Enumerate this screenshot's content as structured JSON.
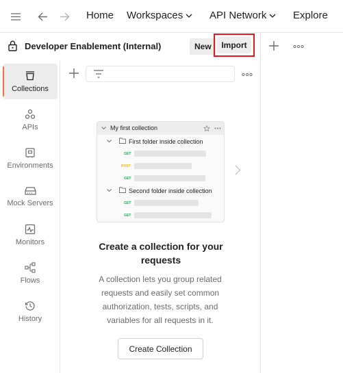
{
  "topnav": {
    "home": "Home",
    "workspaces": "Workspaces",
    "api_network": "API Network",
    "explore": "Explore"
  },
  "workspace": {
    "name": "Developer Enablement (Internal)",
    "new_label": "New",
    "import_label": "Import"
  },
  "rail": {
    "items": [
      {
        "label": "Collections",
        "icon": "collections-icon",
        "active": true
      },
      {
        "label": "APIs",
        "icon": "apis-icon"
      },
      {
        "label": "Environments",
        "icon": "environments-icon"
      },
      {
        "label": "Mock Servers",
        "icon": "mock-servers-icon"
      },
      {
        "label": "Monitors",
        "icon": "monitors-icon"
      },
      {
        "label": "Flows",
        "icon": "flows-icon"
      },
      {
        "label": "History",
        "icon": "history-icon"
      }
    ]
  },
  "illustration": {
    "collection": "My first collection",
    "folder1": "First folder inside collection",
    "folder2": "Second folder inside collection",
    "methods": [
      "GET",
      "POST",
      "GET",
      "GET",
      "GET"
    ]
  },
  "empty_state": {
    "title": "Create a collection for your requests",
    "description": "A collection lets you group related requests and easily set common authorization, tests, scripts, and variables for all requests in it.",
    "button": "Create Collection"
  },
  "colors": {
    "accent": "#ff6c37",
    "highlight": "#e8141b",
    "get": "#0cbb52",
    "post": "#ffb400"
  }
}
